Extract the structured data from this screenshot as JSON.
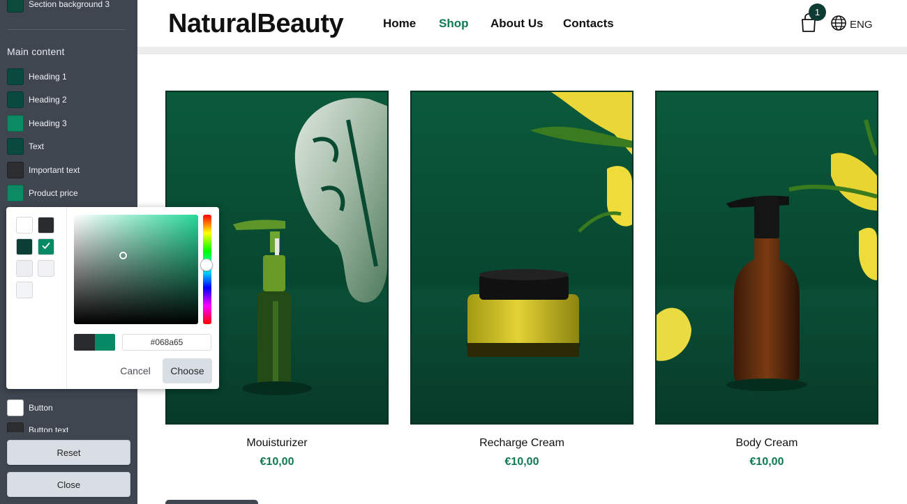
{
  "panel": {
    "top_item": {
      "label": "Section background 3",
      "color": "#0c4a3c"
    },
    "section_title": "Main content",
    "items": [
      {
        "label": "Heading 1",
        "color": "#0a4a3e"
      },
      {
        "label": "Heading 2",
        "color": "#0a4a3e"
      },
      {
        "label": "Heading 3",
        "color": "#0c8a63"
      },
      {
        "label": "Text",
        "color": "#0a4a3e"
      },
      {
        "label": "Important text",
        "color": "#2c2d2f"
      },
      {
        "label": "Product price",
        "color": "#0c8a63"
      }
    ],
    "button_item": {
      "label": "Button",
      "color": "#ffffff"
    },
    "button_text_item": {
      "label": "Button text",
      "color": "#2c2d2f"
    },
    "reset_label": "Reset",
    "close_label": "Close"
  },
  "picker": {
    "swatches": [
      "#ffffff",
      "#2a2b2d",
      "#0b3f35",
      "#068a65",
      "#eceef0",
      "#f1f2f4",
      "#f3f4f6"
    ],
    "selected_swatch": "#068a65",
    "previous_color": "#2a2b2d",
    "new_color": "#068a65",
    "hex_value": "#068a65",
    "cancel_label": "Cancel",
    "choose_label": "Choose"
  },
  "site": {
    "logo": "NaturalBeauty",
    "nav": [
      {
        "label": "Home",
        "active": false
      },
      {
        "label": "Shop",
        "active": true
      },
      {
        "label": "About Us",
        "active": false
      },
      {
        "label": "Contacts",
        "active": false
      }
    ],
    "cart_count": "1",
    "language": "ENG",
    "accent_color": "#0d7a4f"
  },
  "products": [
    {
      "name": "Mouisturizer",
      "price": "€10,00"
    },
    {
      "name": "Recharge Cream",
      "price": "€10,00"
    },
    {
      "name": "Body Cream",
      "price": "€10,00"
    }
  ]
}
